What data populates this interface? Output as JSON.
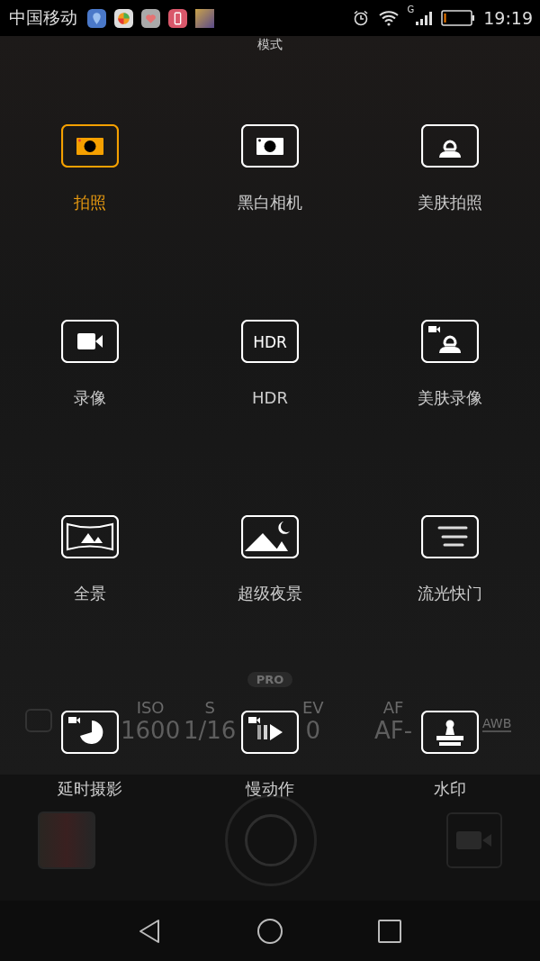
{
  "status_bar": {
    "carrier": "中国移动",
    "time": "19:19",
    "network": "G"
  },
  "title": "模式",
  "hdr_icon_text": "HDR",
  "modes": [
    {
      "label": "拍照",
      "kind": "photo",
      "selected": true
    },
    {
      "label": "黑白相机",
      "kind": "mono",
      "selected": false
    },
    {
      "label": "美肤拍照",
      "kind": "beauty",
      "selected": false
    },
    {
      "label": "录像",
      "kind": "video",
      "selected": false
    },
    {
      "label": "HDR",
      "kind": "hdr",
      "selected": false
    },
    {
      "label": "美肤录像",
      "kind": "beauty-video",
      "selected": false
    },
    {
      "label": "全景",
      "kind": "panorama",
      "selected": false
    },
    {
      "label": "超级夜景",
      "kind": "night",
      "selected": false
    },
    {
      "label": "流光快门",
      "kind": "light",
      "selected": false
    },
    {
      "label": "延时摄影",
      "kind": "timelapse",
      "selected": false
    },
    {
      "label": "慢动作",
      "kind": "slowmo",
      "selected": false
    },
    {
      "label": "水印",
      "kind": "watermark",
      "selected": false
    }
  ],
  "pro_controls": {
    "badge": "PRO",
    "items": [
      {
        "label": "ISO",
        "value": "1600"
      },
      {
        "label": "S",
        "value": "1/16"
      },
      {
        "label": "EV",
        "value": "0"
      },
      {
        "label": "AF",
        "value": "AF-"
      }
    ],
    "awb": "AWB"
  }
}
